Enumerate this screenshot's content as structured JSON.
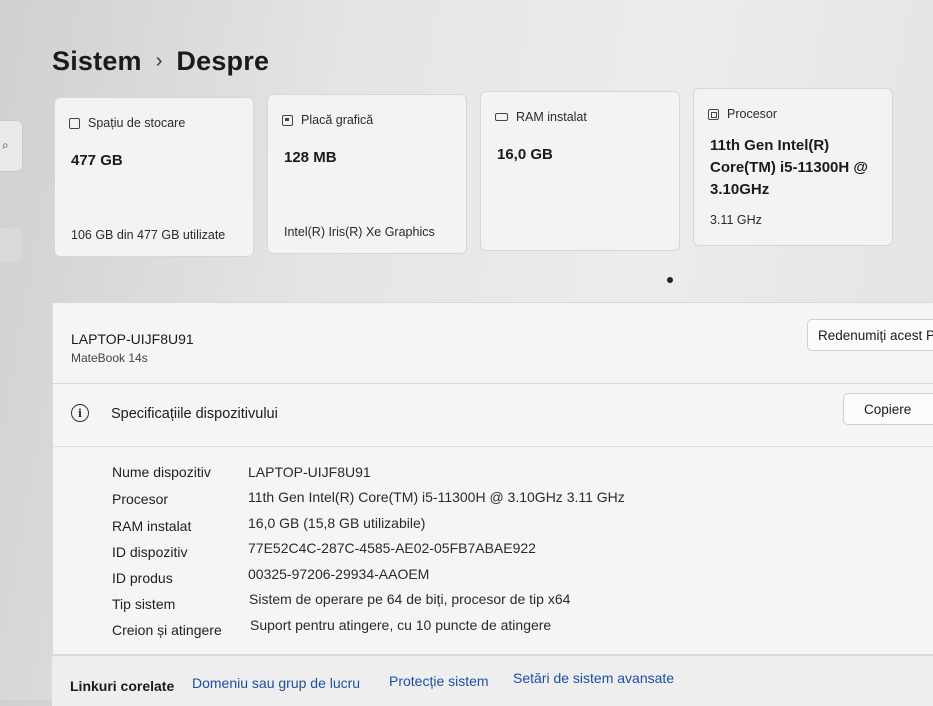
{
  "breadcrumb": {
    "parent": "Sistem",
    "separator": "›",
    "current": "Despre"
  },
  "cards": [
    {
      "title": "Spațiu de stocare",
      "value": "477 GB",
      "sub": "106 GB din 477 GB utilizate",
      "icon": "storage-icon"
    },
    {
      "title": "Placă grafică",
      "value": "128 MB",
      "sub": "Intel(R) Iris(R) Xe Graphics",
      "icon": "gpu-icon"
    },
    {
      "title": "RAM instalat",
      "value": "16,0 GB",
      "sub": "",
      "icon": "ram-icon"
    },
    {
      "title": "Procesor",
      "value_lines": [
        "11th Gen Intel(R)",
        "Core(TM) i5-11300H @",
        "3.10GHz"
      ],
      "sub": "3.11 GHz",
      "icon": "cpu-icon"
    }
  ],
  "device": {
    "name": "LAPTOP-UIJF8U91",
    "model": "MateBook 14s",
    "rename_label": "Redenumiți acest PC"
  },
  "specs": {
    "title": "Specificațiile dispozitivului",
    "copy_label": "Copiere",
    "rows": [
      {
        "key": "Nume dispozitiv",
        "value": "LAPTOP-UIJF8U91"
      },
      {
        "key": "Procesor",
        "value": "11th Gen Intel(R) Core(TM) i5-11300H @ 3.10GHz   3.11 GHz"
      },
      {
        "key": "RAM instalat",
        "value": "16,0 GB (15,8 GB utilizabile)"
      },
      {
        "key": "ID dispozitiv",
        "value": "77E52C4C-287C-4585-AE02-05FB7ABAE922"
      },
      {
        "key": "ID produs",
        "value": "00325-97206-29934-AAOEM"
      },
      {
        "key": "Tip sistem",
        "value": "Sistem de operare pe 64 de biți, procesor de tip x64"
      },
      {
        "key": "Creion și atingere",
        "value": "Suport pentru atingere, cu 10 puncte de atingere"
      }
    ]
  },
  "related": {
    "label": "Linkuri corelate",
    "links": [
      "Domeniu sau grup de lucru",
      "Protecție sistem",
      "Setări de sistem avansate"
    ]
  },
  "colors": {
    "link": "#1d4fa0",
    "card_bg": "#f3f3f4"
  }
}
